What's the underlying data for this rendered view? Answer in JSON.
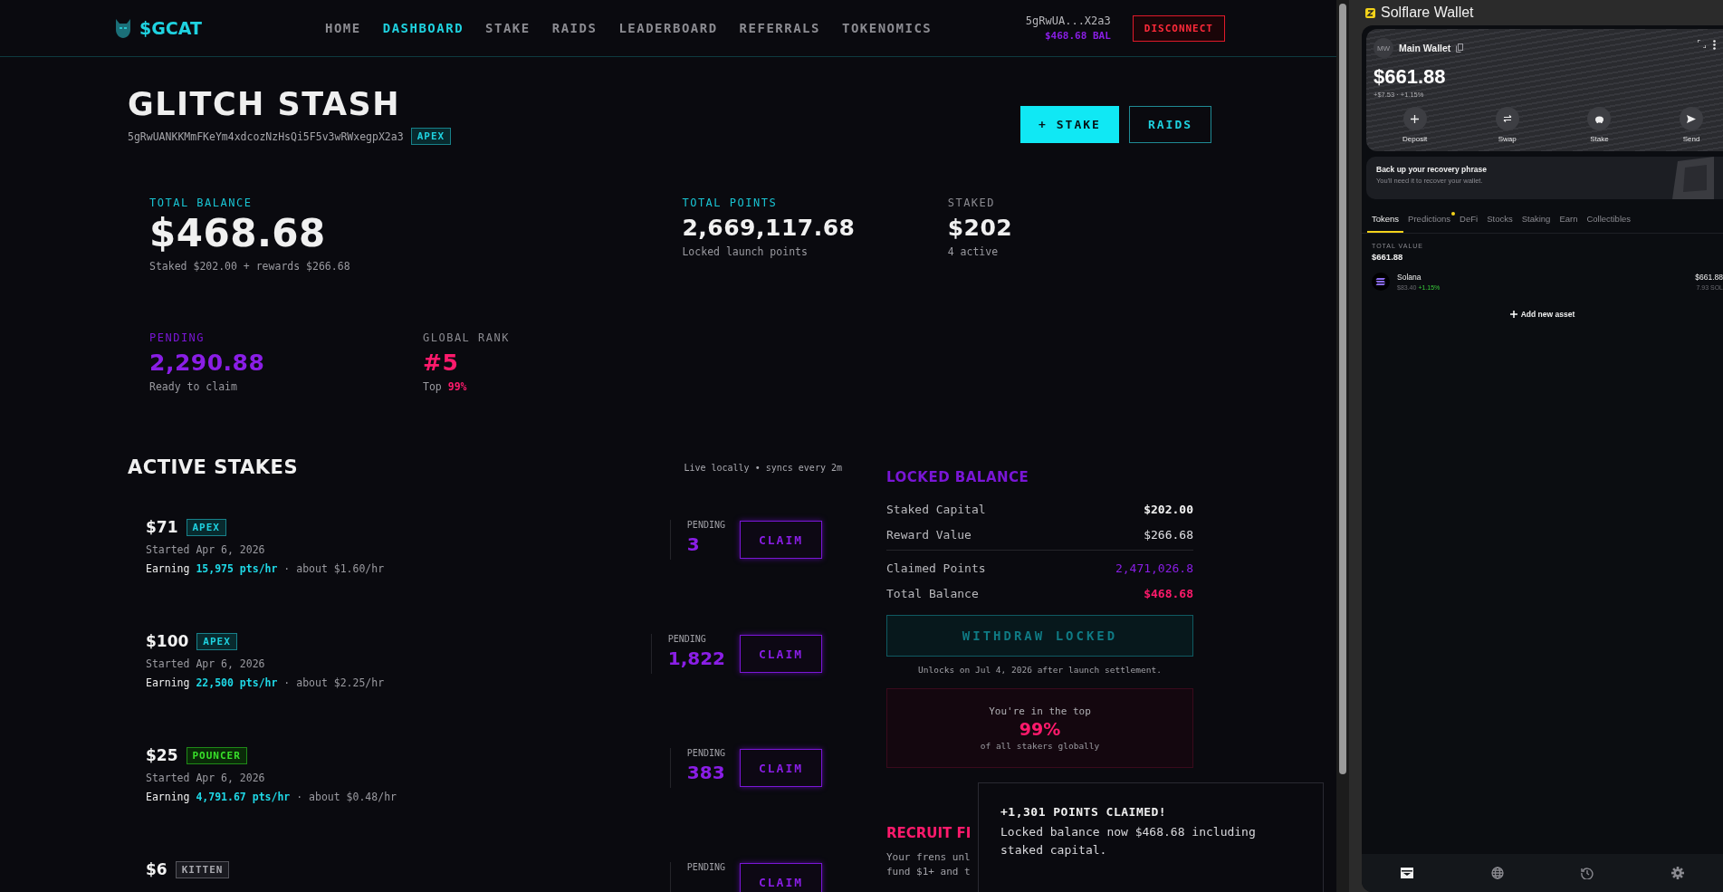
{
  "header": {
    "logo": "$GCAT",
    "nav": [
      {
        "label": "HOME",
        "selected": false
      },
      {
        "label": "DASHBOARD",
        "selected": true
      },
      {
        "label": "STAKE",
        "selected": false
      },
      {
        "label": "RAIDS",
        "selected": false
      },
      {
        "label": "LEADERBOARD",
        "selected": false
      },
      {
        "label": "REFERRALS",
        "selected": false
      },
      {
        "label": "TOKENOMICS",
        "selected": false
      }
    ],
    "wallet_address": "5gRwUA...X2a3",
    "balance": "$468.68 BAL",
    "disconnect": "DISCONNECT"
  },
  "profile": {
    "title": "GLITCH STASH",
    "address": "5gRwUANKKMmFKeYm4xdcozNzHsQi5F5v3wRWxegpX2a3",
    "tier": "APEX",
    "actions": [
      {
        "label": "+ STAKE",
        "kind": "primary"
      },
      {
        "label": "RAIDS",
        "kind": "outline"
      }
    ]
  },
  "stats": [
    [
      {
        "label": "TOTAL BALANCE",
        "value": "$468.68",
        "sub": "Staked $202.00 + rewards $266.68",
        "kind": "balance"
      },
      {
        "label": "TOTAL POINTS",
        "value": "2,669,117.68",
        "sub": "Locked launch points",
        "kind": "points"
      },
      {
        "label": "STAKED",
        "value": "$202",
        "sub": "4 active",
        "kind": "staked"
      }
    ],
    [
      {
        "label": "PENDING",
        "value": "2,290.88",
        "sub": "Ready to claim",
        "kind": "pending"
      },
      {
        "label": "GLOBAL RANK",
        "value": "#5",
        "sub": "Top **99%**",
        "kind": "rank"
      }
    ]
  ],
  "active_stakes": {
    "title": "ACTIVE STAKES",
    "sync_note": "Live locally • syncs every 2m",
    "stakes": [
      {
        "amount": "$71",
        "tier": "APEX",
        "kind": "apex",
        "started": "Started Apr 6, 2026",
        "earning": "Earning",
        "rate": "15,975 pts/hr",
        "about": "· about $1.60/hr",
        "pending_label": "PENDING",
        "pending": "3",
        "claim": "CLAIM"
      },
      {
        "amount": "$100",
        "tier": "APEX",
        "kind": "apex",
        "started": "Started Apr 6, 2026",
        "earning": "Earning",
        "rate": "22,500 pts/hr",
        "about": "· about $2.25/hr",
        "pending_label": "PENDING",
        "pending": "1,822",
        "claim": "CLAIM"
      },
      {
        "amount": "$25",
        "tier": "POUNCER",
        "kind": "pouncer",
        "started": "Started Apr 6, 2026",
        "earning": "Earning",
        "rate": "4,791.67 pts/hr",
        "about": "· about $0.48/hr",
        "pending_label": "PENDING",
        "pending": "383",
        "claim": "CLAIM"
      },
      {
        "amount": "$6",
        "tier": "KITTEN",
        "kind": "kitten",
        "pending_label": "PENDING",
        "claim": "CLAIM"
      }
    ]
  },
  "locked_balance": {
    "title": "LOCKED BALANCE",
    "rows": [
      {
        "label": "Staked Capital",
        "value": "$202.00",
        "kind": "capital"
      },
      {
        "label": "Reward Value",
        "value": "$266.68",
        "kind": "reward"
      },
      {
        "label": "Claimed Points",
        "value": "2,471,026.8",
        "kind": "points"
      },
      {
        "label": "Total Balance",
        "value": "$468.68",
        "kind": "total"
      }
    ],
    "withdraw": {
      "label": "WITHDRAW LOCKED",
      "disabled": true
    },
    "unlock_note": "Unlocks on Jul 4, 2026 after launch settlement.",
    "rank_card": {
      "lead": "You're in the top",
      "percent": "99%",
      "tail": "of all stakers globally"
    }
  },
  "recruit": {
    "title": "RECRUIT FI",
    "lines": [
      "Your frens unl",
      "fund $1+ and t"
    ]
  },
  "toast": {
    "title": "+1,301 POINTS CLAIMED!",
    "message": "Locked balance now $468.68 including staked capital."
  },
  "wallet": {
    "title": "Solflare Wallet",
    "account": {
      "initials": "MW",
      "name": "Main Wallet"
    },
    "balance": "$661.88",
    "change": "+$7.53 · +1.15%",
    "actions": [
      {
        "label": "Deposit",
        "kind": "plus"
      },
      {
        "label": "Swap",
        "kind": "swap"
      },
      {
        "label": "Stake",
        "kind": "piggy"
      },
      {
        "label": "Send",
        "kind": "send"
      }
    ],
    "backup": {
      "title": "Back up your recovery phrase",
      "subtitle": "You'll need it to recover your wallet."
    },
    "tabs": [
      {
        "label": "Tokens",
        "selected": true,
        "dot": false
      },
      {
        "label": "Predictions",
        "selected": false,
        "dot": true
      },
      {
        "label": "DeFi",
        "selected": false,
        "dot": false
      },
      {
        "label": "Stocks",
        "selected": false,
        "dot": false
      },
      {
        "label": "Staking",
        "selected": false,
        "dot": false
      },
      {
        "label": "Earn",
        "selected": false,
        "dot": false
      },
      {
        "label": "Collectibles",
        "selected": false,
        "dot": false
      }
    ],
    "total_label": "TOTAL VALUE",
    "total": "$661.88",
    "assets": [
      {
        "name": "Solana",
        "price": "$83.40",
        "change": "+1.15%",
        "value": "$661.88",
        "amount": "7.93 SOL"
      }
    ],
    "add_asset": "Add new asset",
    "bottom_nav": [
      {
        "kind": "wallet",
        "selected": true
      },
      {
        "kind": "globe",
        "selected": false
      },
      {
        "kind": "history",
        "selected": false
      },
      {
        "kind": "settings",
        "selected": false
      }
    ]
  }
}
